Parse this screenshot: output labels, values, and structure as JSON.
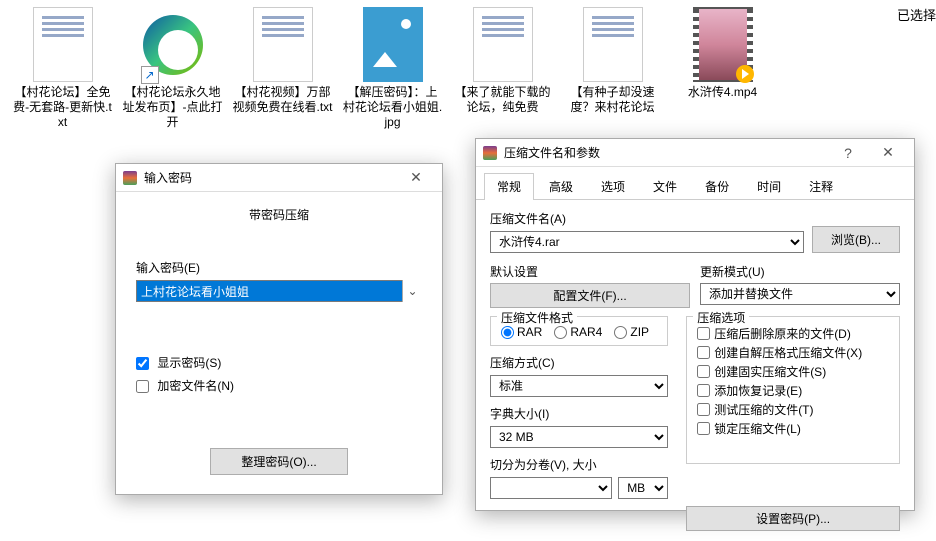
{
  "side_text": "已选择",
  "files": [
    {
      "type": "txt",
      "label": "【村花论坛】全免费-无套路-更新快.txt"
    },
    {
      "type": "edge",
      "label": "【村花论坛永久地址发布页】-点此打开"
    },
    {
      "type": "txt",
      "label": "【村花视频】万部视频免费在线看.txt"
    },
    {
      "type": "jpg",
      "label": "【解压密码】：上村花论坛看小姐姐.jpg"
    },
    {
      "type": "txt",
      "label": "【来了就能下载的论坛，纯免费"
    },
    {
      "type": "txt",
      "label": "【有种子却没速度？来村花论坛"
    },
    {
      "type": "mp4",
      "label": "水浒传4.mp4"
    }
  ],
  "pwd_dialog": {
    "title": "输入密码",
    "heading": "带密码压缩",
    "input_label": "输入密码(E)",
    "input_value": "上村花论坛看小姐姐",
    "show_pwd": "显示密码(S)",
    "encrypt_names": "加密文件名(N)",
    "organize": "整理密码(O)..."
  },
  "archive_dialog": {
    "title": "压缩文件名和参数",
    "help": "?",
    "tabs": [
      "常规",
      "高级",
      "选项",
      "文件",
      "备份",
      "时间",
      "注释"
    ],
    "archive_name_label": "压缩文件名(A)",
    "archive_name_value": "水浒传4.rar",
    "browse": "浏览(B)...",
    "default_profile_label": "默认设置",
    "profile_btn": "配置文件(F)...",
    "update_mode_label": "更新模式(U)",
    "update_mode_value": "添加并替换文件",
    "format_label": "压缩文件格式",
    "formats": [
      "RAR",
      "RAR4",
      "ZIP"
    ],
    "method_label": "压缩方式(C)",
    "method_value": "标准",
    "dict_label": "字典大小(I)",
    "dict_value": "32 MB",
    "split_label": "切分为分卷(V), 大小",
    "split_unit": "MB",
    "options_label": "压缩选项",
    "options": [
      "压缩后删除原来的文件(D)",
      "创建自解压格式压缩文件(X)",
      "创建固实压缩文件(S)",
      "添加恢复记录(E)",
      "测试压缩的文件(T)",
      "锁定压缩文件(L)"
    ],
    "set_pwd": "设置密码(P)..."
  }
}
